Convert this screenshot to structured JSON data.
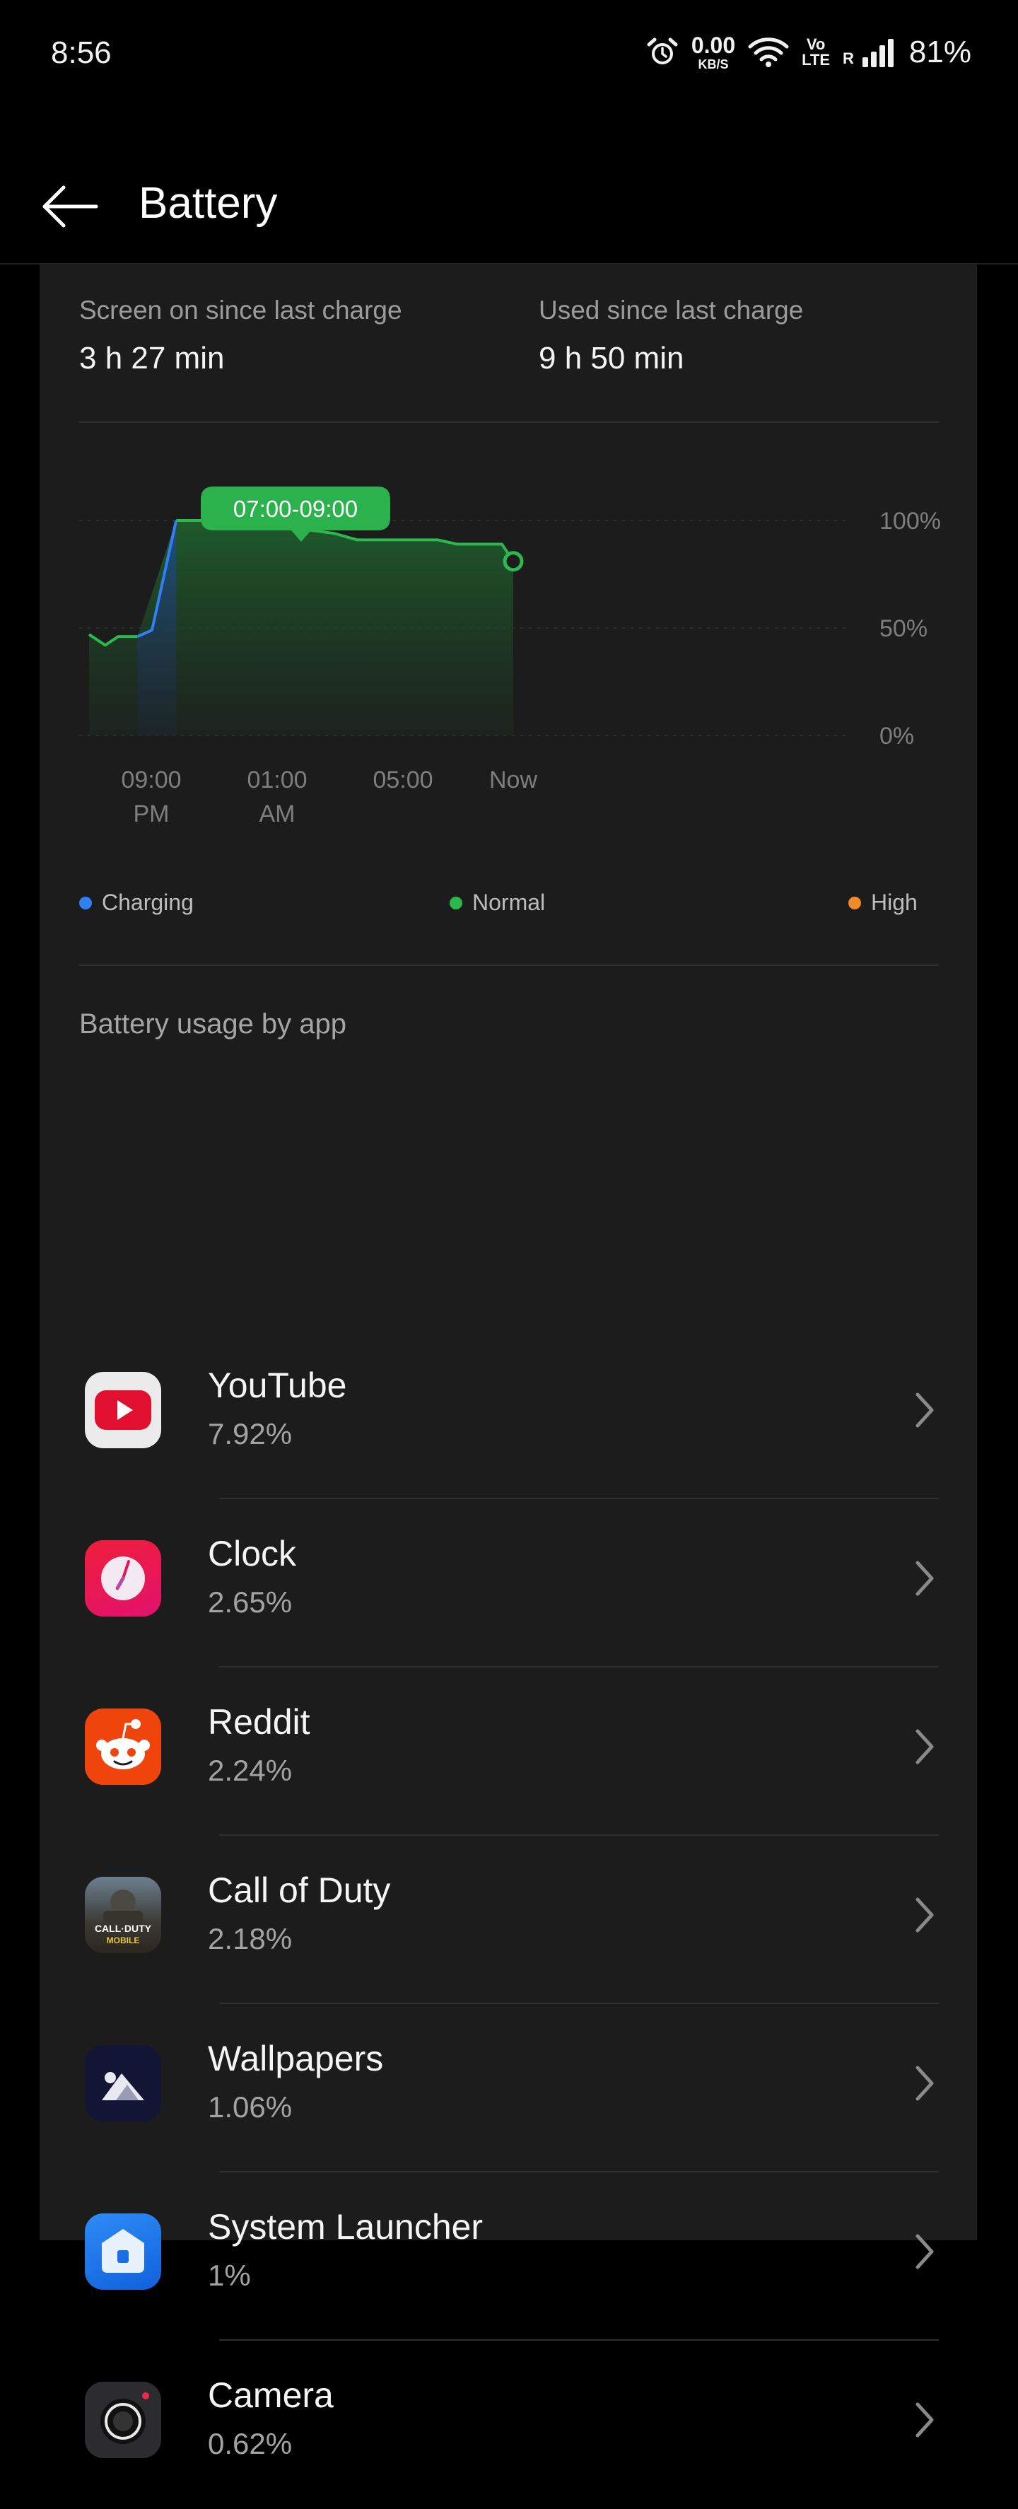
{
  "status_bar": {
    "time": "8:56",
    "net_speed_value": "0.00",
    "net_speed_unit": "KB/S",
    "volte_top": "Vo",
    "volte_bottom": "LTE",
    "roaming": "R",
    "battery_percent": "81%",
    "icons": [
      "alarm-icon",
      "wifi-icon",
      "signal-icon"
    ]
  },
  "header": {
    "title": "Battery",
    "back_icon": "back-arrow-icon"
  },
  "summary": {
    "screen_on_label": "Screen on since last charge",
    "screen_on_value": "3 h 27 min",
    "used_label": "Used since last charge",
    "used_value": "9 h 50 min"
  },
  "chart_data": {
    "type": "line",
    "tooltip": "07:00-09:00",
    "y_ticks": [
      "100%",
      "50%",
      "0%"
    ],
    "x_ticks": [
      {
        "line1": "09:00",
        "line2": "PM"
      },
      {
        "line1": "01:00",
        "line2": "AM"
      },
      {
        "line1": "05:00",
        "line2": ""
      },
      {
        "line1": "Now",
        "line2": ""
      }
    ],
    "ylim": [
      0,
      100
    ],
    "x_range_hours": [
      -1.1,
      12.05
    ],
    "series": [
      {
        "name": "Charging",
        "color": "#2f80f2",
        "x": [
          0.4,
          0.85,
          1.6
        ],
        "y": [
          46,
          49,
          100
        ]
      },
      {
        "name": "Normal",
        "color": "#2db84d",
        "x": [
          -1.1,
          -0.6,
          -0.2,
          0.4,
          1.6,
          3.5,
          6.5,
          7.2,
          9.7,
          10.3,
          11.7,
          12.05
        ],
        "y": [
          47,
          42,
          46,
          46,
          100,
          100,
          94,
          91,
          91,
          89,
          89,
          81
        ]
      }
    ],
    "legend": [
      {
        "label": "Charging",
        "color": "#2f80f2"
      },
      {
        "label": "Normal",
        "color": "#2db84d"
      },
      {
        "label": "High",
        "color": "#f08a24"
      }
    ],
    "grid": true
  },
  "usage_section": {
    "title": "Battery usage by app",
    "apps": [
      {
        "name": "YouTube",
        "percent": "7.92%",
        "icon": "youtube-icon"
      },
      {
        "name": "Clock",
        "percent": "2.65%",
        "icon": "clock-icon"
      },
      {
        "name": "Reddit",
        "percent": "2.24%",
        "icon": "reddit-icon"
      },
      {
        "name": "Call of Duty",
        "percent": "2.18%",
        "icon": "call-of-duty-icon",
        "icon_text_1": "CALL·DUTY",
        "icon_text_2": "MOBILE"
      },
      {
        "name": "Wallpapers",
        "percent": "1.06%",
        "icon": "wallpapers-icon"
      },
      {
        "name": "System Launcher",
        "percent": "1%",
        "icon": "system-launcher-icon"
      },
      {
        "name": "Camera",
        "percent": "0.62%",
        "icon": "camera-icon"
      }
    ]
  }
}
